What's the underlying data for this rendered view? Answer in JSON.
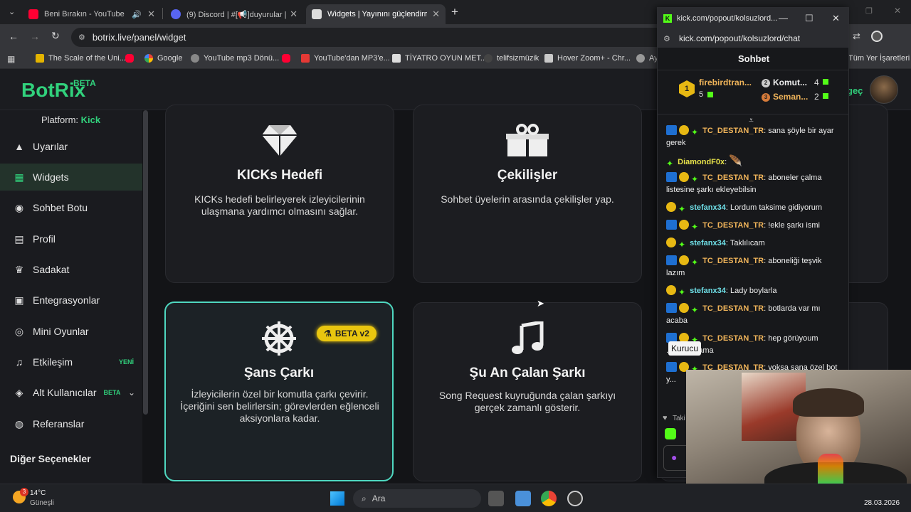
{
  "browser": {
    "tabs": [
      {
        "title": "Beni Bırakın - YouTube",
        "icon": "youtube-icon"
      },
      {
        "title": "(9) Discord | #[📢]duyurular | K",
        "icon": "discord-icon"
      },
      {
        "title": "Widgets | Yayınını güçlendirme",
        "icon": "botrix-icon"
      }
    ],
    "url": "botrix.live/panel/widget",
    "bookmarks": [
      "The Scale of the Uni...",
      "Google",
      "YouTube mp3 Dönü...",
      "YouTube'dan MP3'e...",
      "TİYATRO OYUN MET...",
      "telifsizmüzik",
      "Hover Zoom+ - Chr...",
      "Ay"
    ],
    "all_bookmarks": "Tüm Yer İşaretleri"
  },
  "app": {
    "logo": "BotRix",
    "logo_badge": "BETA",
    "platform_label": "Platform:",
    "platform_value": "Kick",
    "user_fragment": "geç",
    "nav": [
      {
        "label": "Uyarılar",
        "icon": "alert-icon"
      },
      {
        "label": "Widgets",
        "icon": "widgets-icon"
      },
      {
        "label": "Sohbet Botu",
        "icon": "bot-icon"
      },
      {
        "label": "Profil",
        "icon": "profile-icon"
      },
      {
        "label": "Sadakat",
        "icon": "trophy-icon"
      },
      {
        "label": "Entegrasyonlar",
        "icon": "integrations-icon"
      },
      {
        "label": "Mini Oyunlar",
        "icon": "gamepad-icon"
      },
      {
        "label": "Etkileşim",
        "icon": "music-note-icon",
        "tag": "YENİ"
      },
      {
        "label": "Alt Kullanıcılar",
        "icon": "users-icon",
        "tag": "BETA"
      },
      {
        "label": "Referanslar",
        "icon": "referral-icon"
      }
    ],
    "more_options": "Diğer Seçenekler"
  },
  "cards": [
    {
      "title": "KICKs Hedefi",
      "desc": "KICKs hedefi belirleyerek izleyicilerinin ulaşmana yardımcı olmasını sağlar.",
      "icon": "diamond-icon"
    },
    {
      "title": "Çekilişler",
      "desc": "Sohbet üyelerin arasında çekilişler yap.",
      "icon": "gift-icon"
    },
    {
      "title": "Şans Çarkı",
      "desc": "İzleyicilerin özel bir komutla çarkı çevirir. İçeriğini sen belirlersin; görevlerden eğlenceli aksiyonlara kadar.",
      "icon": "wheel-icon",
      "badge": "BETA v2"
    },
    {
      "title": "Şu An Çalan Şarkı",
      "desc": "Song Request kuyruğunda çalan şarkıyı gerçek zamanlı gösterir.",
      "icon": "music-icon"
    }
  ],
  "popout": {
    "window_title": "kick.com/popout/kolsuzlord...",
    "url": "kick.com/popout/kolsuzlord/chat",
    "header": "Sohbet",
    "leaderboard": {
      "first": {
        "rank": "1",
        "name": "firebirdtran...",
        "count": "5"
      },
      "second": {
        "rank": "2",
        "name": "Komut...",
        "count": "4"
      },
      "third": {
        "rank": "3",
        "name": "Seman...",
        "count": "2"
      }
    },
    "messages": [
      {
        "user": "TC_DESTAN_TR",
        "text": "sana şöyle bir ayar gerek",
        "color": "#f0b45a",
        "badges": 3
      },
      {
        "user": "DiamondF0x",
        "text": "",
        "color": "#e7e24a",
        "badges": 1
      },
      {
        "user": "TC_DESTAN_TR",
        "text": "aboneler çalma listesine şarkı ekleyebilsin",
        "color": "#f0b45a",
        "badges": 3
      },
      {
        "user": "stefanx34",
        "text": "Lordum taksime gidiyorum",
        "color": "#6fe0e8",
        "badges": 2
      },
      {
        "user": "TC_DESTAN_TR",
        "text": "!ekle şarkı ismi",
        "color": "#f0b45a",
        "badges": 3
      },
      {
        "user": "stefanx34",
        "text": "Taklılıcam",
        "color": "#6fe0e8",
        "badges": 2
      },
      {
        "user": "TC_DESTAN_TR",
        "text": "aboneliği teşvik lazım",
        "color": "#f0b45a",
        "badges": 3
      },
      {
        "user": "stefanx34",
        "text": "Lady boylarla",
        "color": "#6fe0e8",
        "badges": 2
      },
      {
        "user": "TC_DESTAN_TR",
        "text": "botlarda var mı acaba",
        "color": "#f0b45a",
        "badges": 3
      },
      {
        "user": "TC_DESTAN_TR",
        "text": "hep görüyoum ...allarda ama",
        "color": "#f0b45a",
        "badges": 3
      },
      {
        "user": "TC_DESTAN_TR",
        "text": "yoksa sana özel bot y...",
        "color": "#f0b45a",
        "badges": 3
      }
    ],
    "tooltip": "Kurucu",
    "footer_fragment": "Taki"
  },
  "taskbar": {
    "weather_temp": "14°C",
    "weather_desc": "Güneşli",
    "weather_badge": "3",
    "search": "Ara",
    "date": "28.03.2026"
  }
}
